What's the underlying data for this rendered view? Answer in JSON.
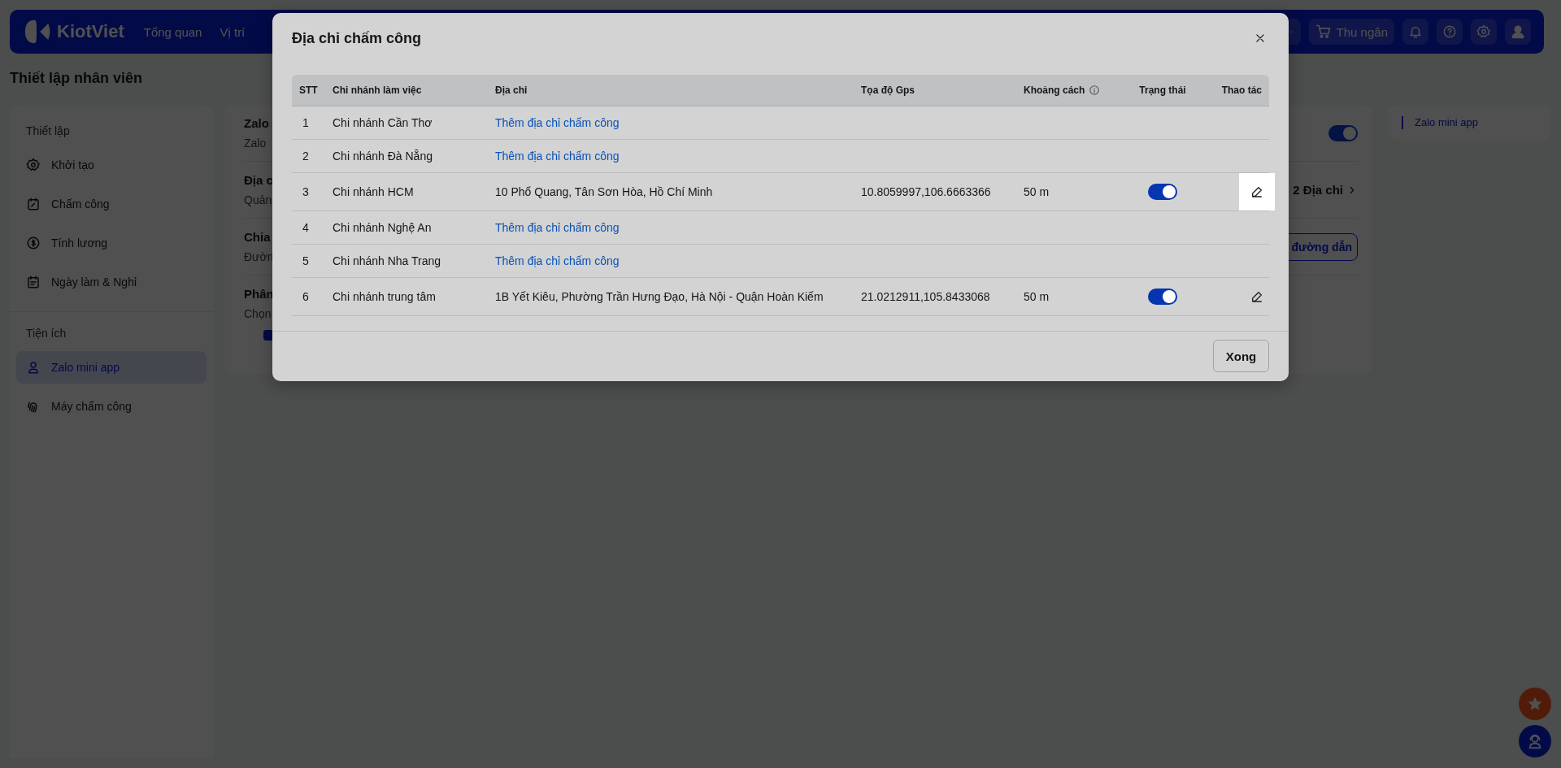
{
  "topbar": {
    "brand": "KiotViet",
    "nav": [
      {
        "label": "Tổng quan"
      },
      {
        "label": "Vị trí"
      }
    ],
    "cashier_button": "Thu ngân"
  },
  "page_title": "Thiết lập nhân viên",
  "sidebar": {
    "sections": [
      {
        "heading": "Thiết lập",
        "items": [
          {
            "label": "Khởi tạo",
            "selected": false
          },
          {
            "label": "Chấm công",
            "selected": false
          },
          {
            "label": "Tính lương",
            "selected": false
          },
          {
            "label": "Ngày làm & Nghỉ",
            "selected": false
          }
        ]
      },
      {
        "heading": "Tiện ích",
        "items": [
          {
            "label": "Zalo mini app",
            "selected": true
          },
          {
            "label": "Máy chấm công",
            "selected": false
          }
        ]
      }
    ]
  },
  "main_card": {
    "title": "Zalo",
    "subtitle": "Zalo",
    "toggle_on": true,
    "sections": [
      {
        "kind": "link",
        "title": "Địa c",
        "text": "Quản",
        "action": "2 Địa chỉ"
      },
      {
        "kind": "button",
        "title": "Chia",
        "text": "Đườn",
        "action": "đường dẫn"
      },
      {
        "kind": "checkbox",
        "title": "Phân",
        "text": "Chọn",
        "checked": true
      }
    ]
  },
  "right_panel": {
    "item": "Zalo mini app"
  },
  "dialog": {
    "title": "Địa chỉ chấm công",
    "columns": [
      "STT",
      "Chi nhánh làm việc",
      "Địa chỉ",
      "Tọa độ Gps",
      "Khoảng cách",
      "Trạng thái",
      "Thao tác"
    ],
    "rows": [
      {
        "kind": "add",
        "stt": "1",
        "branch": "Chi nhánh Cần Thơ",
        "address": "Thêm địa chỉ chấm công"
      },
      {
        "kind": "add",
        "stt": "2",
        "branch": "Chi nhánh Đà Nẵng",
        "address": "Thêm địa chỉ chấm công"
      },
      {
        "kind": "set",
        "stt": "3",
        "branch": "Chi nhánh HCM",
        "address": "10 Phổ Quang,  Tân Sơn Hòa, Hồ Chí Minh",
        "gps": "10.8059997,106.6663366",
        "distance": "50 m",
        "on": true,
        "highlighted": true
      },
      {
        "kind": "add",
        "stt": "4",
        "branch": "Chi nhánh Nghệ An",
        "address": "Thêm địa chỉ chấm công"
      },
      {
        "kind": "add",
        "stt": "5",
        "branch": "Chi nhánh Nha Trang",
        "address": "Thêm địa chỉ chấm công"
      },
      {
        "kind": "set",
        "stt": "6",
        "branch": "Chi nhánh trung tâm",
        "address": "1B Yết Kiêu, Phường Trần Hưng Đạo, Hà Nội - Quận Hoàn Kiếm",
        "gps": "21.0212911,105.8433068",
        "distance": "50 m",
        "on": true,
        "highlighted": false
      }
    ],
    "done_button": "Xong"
  }
}
